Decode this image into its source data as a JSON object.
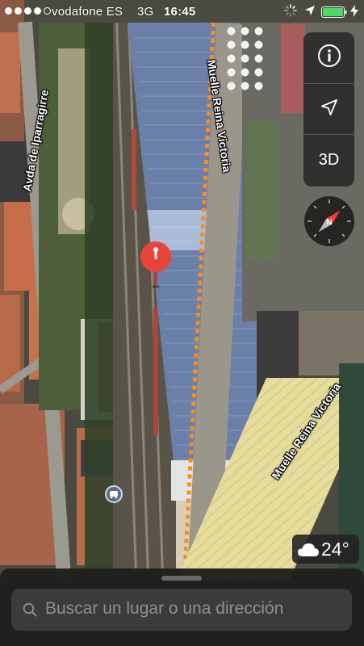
{
  "status_bar": {
    "signal_filled": 4,
    "signal_total": 5,
    "carrier": "vodafone ES",
    "network": "3G",
    "time": "16:45",
    "battery_color": "#4cd964"
  },
  "map": {
    "roads": {
      "avda": "Avda de Iparragirre",
      "muelle_top": "Muelle Reina Victoria",
      "muelle_bottom": "Muelle Reina Victoria"
    },
    "pin_color": "#e8443a",
    "pin_icon": "map-pin-icon",
    "transit_icon": "transit-icon"
  },
  "controls": {
    "info_icon": "info-icon",
    "location_icon": "location-arrow-icon",
    "three_d_label": "3D",
    "compass_needle_color": "#ff3b30"
  },
  "weather": {
    "icon": "cloud-icon",
    "temperature": "24°"
  },
  "search": {
    "placeholder": "Buscar un lugar o una dirección"
  }
}
